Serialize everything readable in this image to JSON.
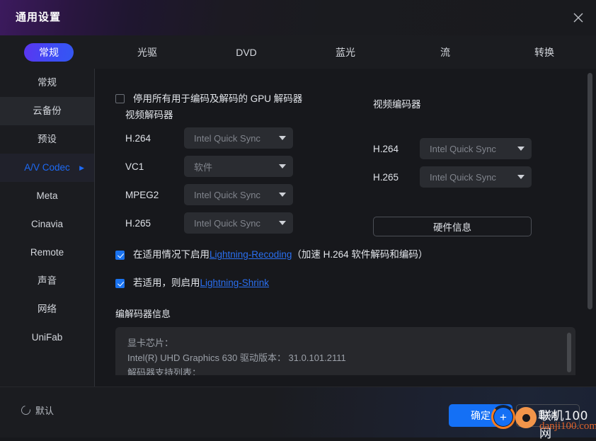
{
  "window": {
    "title": "通用设置",
    "close_icon": "close-icon"
  },
  "tabs": [
    {
      "label": "常规",
      "active": true
    },
    {
      "label": "光驱",
      "active": false
    },
    {
      "label": "DVD",
      "active": false
    },
    {
      "label": "蓝光",
      "active": false
    },
    {
      "label": "流",
      "active": false
    },
    {
      "label": "转换",
      "active": false
    }
  ],
  "sidebar": {
    "items": [
      {
        "label": "常规",
        "selected": false
      },
      {
        "label": "云备份",
        "selected": false
      },
      {
        "label": "预设",
        "selected": false
      },
      {
        "label": "A/V Codec",
        "selected": true,
        "caret": "▶"
      },
      {
        "label": "Meta",
        "selected": false
      },
      {
        "label": "Cinavia",
        "selected": false
      },
      {
        "label": "Remote",
        "selected": false
      },
      {
        "label": "声音",
        "selected": false
      },
      {
        "label": "网络",
        "selected": false
      },
      {
        "label": "UniFab",
        "selected": false
      }
    ]
  },
  "main": {
    "disable_gpu": {
      "label": "停用所有用于编码及解码的 GPU 解码器",
      "checked": false
    },
    "decoder_section_title": "视频解码器",
    "encoder_section_title": "视频编码器",
    "decoders": [
      {
        "name": "H.264",
        "value": "Intel Quick Sync"
      },
      {
        "name": "VC1",
        "value": "软件"
      },
      {
        "name": "MPEG2",
        "value": "Intel Quick Sync"
      },
      {
        "name": "H.265",
        "value": "Intel Quick Sync"
      }
    ],
    "encoders": [
      {
        "name": "H.264",
        "value": "Intel Quick Sync"
      },
      {
        "name": "H.265",
        "value": "Intel Quick Sync"
      }
    ],
    "hardware_info_button": "硬件信息",
    "lightning_recoding": {
      "checked": true,
      "prefix": "在适用情况下启用",
      "link": "Lightning-Recoding",
      "suffix": "（加速 H.264 软件解码和编码）"
    },
    "lightning_shrink": {
      "checked": true,
      "prefix": "若适用，则启用",
      "link": "Lightning-Shrink",
      "suffix": ""
    },
    "codec_info_title": "编解码器信息",
    "codec_info_lines": [
      "显卡芯片：",
      "Intel(R) UHD Graphics 630 驱动版本： 31.0.101.2111",
      "解码器支持列表："
    ]
  },
  "footer": {
    "default_label": "默认",
    "ok_label": "确定",
    "cancel_label": "取消"
  },
  "watermark": {
    "name": "联机100网",
    "url": "danji100.com"
  },
  "colors": {
    "accent_blue": "#1470f5",
    "link_blue": "#2a6ff0",
    "tab_active_gradient_start": "#5b35f0",
    "tab_active_gradient_end": "#3457f2",
    "sidebar_selected_text": "#1d6af5",
    "background": "#17181c",
    "panel": "#1b1c20",
    "watermark_orange": "#e0632a"
  }
}
